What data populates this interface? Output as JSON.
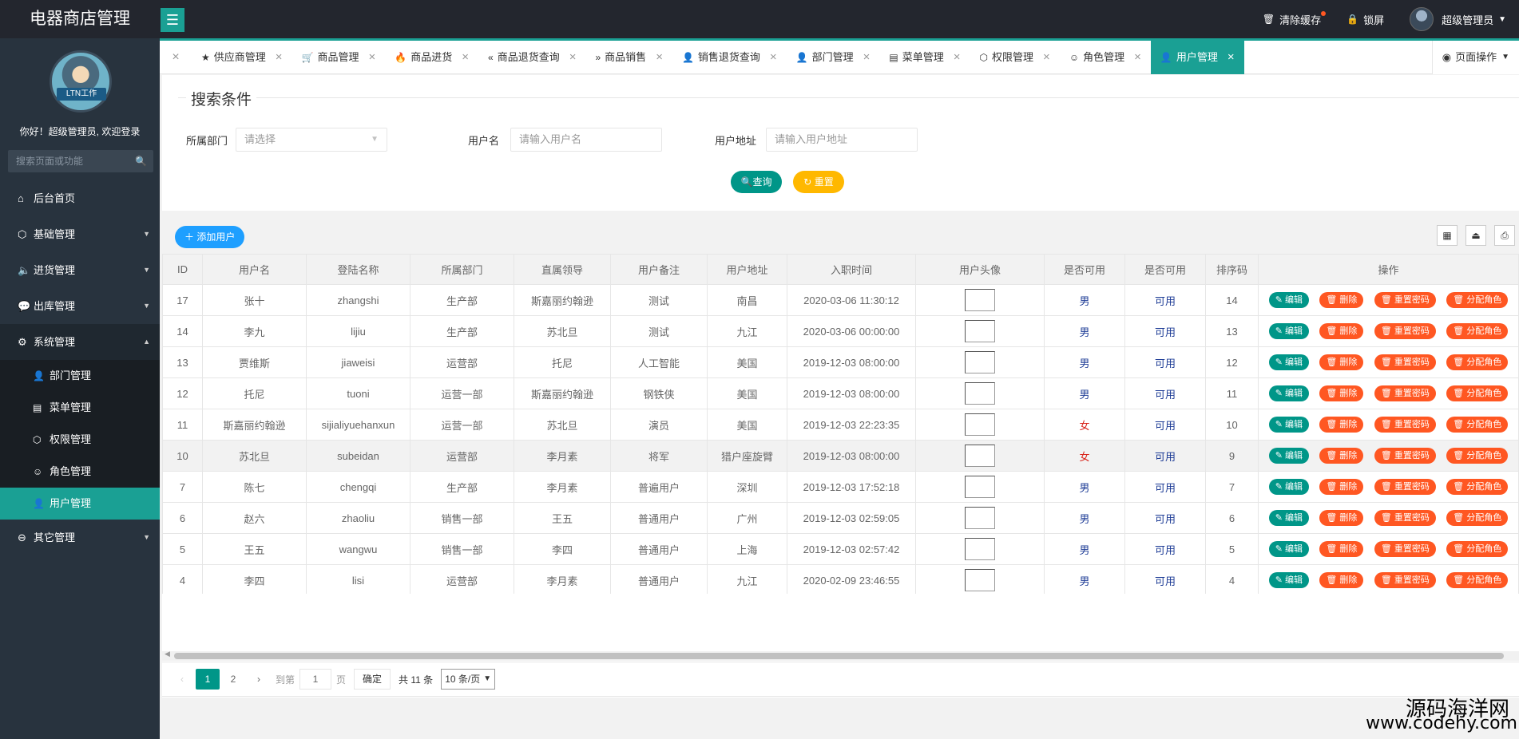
{
  "header": {
    "app_title": "电器商店管理",
    "clear_cache": "清除缓存",
    "lock_screen": "锁屏",
    "user_name": "超级管理员"
  },
  "sidebar": {
    "avatar_caption": "LTN工作",
    "welcome": "你好！超级管理员, 欢迎登录",
    "search_placeholder": "搜索页面或功能",
    "nav": [
      {
        "label": "后台首页",
        "icon": "home-icon"
      },
      {
        "label": "基础管理",
        "icon": "cube-icon"
      },
      {
        "label": "进货管理",
        "icon": "volume-icon"
      },
      {
        "label": "出库管理",
        "icon": "chat-icon"
      },
      {
        "label": "系统管理",
        "icon": "gear-icon"
      },
      {
        "label": "其它管理",
        "icon": "circle-arrow-icon"
      }
    ],
    "sub": [
      {
        "label": "部门管理",
        "icon": "user-outline-icon"
      },
      {
        "label": "菜单管理",
        "icon": "menu-icon"
      },
      {
        "label": "权限管理",
        "icon": "cube-icon"
      },
      {
        "label": "角色管理",
        "icon": "smile-icon"
      },
      {
        "label": "用户管理",
        "icon": "user-icon"
      }
    ]
  },
  "tabs": [
    {
      "label": "供应商管理",
      "icon": "star-icon"
    },
    {
      "label": "商品管理",
      "icon": "cart-icon"
    },
    {
      "label": "商品进货",
      "icon": "fire-icon"
    },
    {
      "label": "商品退货查询",
      "icon": "double-left-icon"
    },
    {
      "label": "商品销售",
      "icon": "double-right-icon"
    },
    {
      "label": "销售退货查询",
      "icon": "user-outline-icon"
    },
    {
      "label": "部门管理",
      "icon": "user-outline-icon"
    },
    {
      "label": "菜单管理",
      "icon": "menu-icon"
    },
    {
      "label": "权限管理",
      "icon": "cube-icon"
    },
    {
      "label": "角色管理",
      "icon": "smile-icon"
    },
    {
      "label": "用户管理",
      "icon": "user-icon"
    }
  ],
  "tab_ops": "页面操作",
  "search": {
    "legend": "搜索条件",
    "dept_label": "所属部门",
    "dept_placeholder": "请选择",
    "username_label": "用户名",
    "username_placeholder": "请输入用户名",
    "address_label": "用户地址",
    "address_placeholder": "请输入用户地址",
    "query_btn": "查询",
    "reset_btn": "重置"
  },
  "toolbar": {
    "add_btn": "添加用户"
  },
  "table": {
    "headers": [
      "ID",
      "用户名",
      "登陆名称",
      "所属部门",
      "直属领导",
      "用户备注",
      "用户地址",
      "入职时间",
      "用户头像",
      "是否可用",
      "是否可用",
      "排序码",
      "操作"
    ],
    "ops": {
      "edit": "编辑",
      "delete": "删除",
      "reset_pwd": "重置密码",
      "assign_role": "分配角色"
    },
    "rows": [
      {
        "id": "17",
        "name": "张十",
        "login": "zhangshi",
        "dept": "生产部",
        "leader": "斯嘉丽约翰逊",
        "remark": "测试",
        "address": "南昌",
        "time": "2020-03-06 11:30:12",
        "sex": "男",
        "avail": "可用",
        "order": "14"
      },
      {
        "id": "14",
        "name": "李九",
        "login": "lijiu",
        "dept": "生产部",
        "leader": "苏北旦",
        "remark": "测试",
        "address": "九江",
        "time": "2020-03-06 00:00:00",
        "sex": "男",
        "avail": "可用",
        "order": "13"
      },
      {
        "id": "13",
        "name": "贾维斯",
        "login": "jiaweisi",
        "dept": "运营部",
        "leader": "托尼",
        "remark": "人工智能",
        "address": "美国",
        "time": "2019-12-03 08:00:00",
        "sex": "男",
        "avail": "可用",
        "order": "12"
      },
      {
        "id": "12",
        "name": "托尼",
        "login": "tuoni",
        "dept": "运营一部",
        "leader": "斯嘉丽约翰逊",
        "remark": "钢铁侠",
        "address": "美国",
        "time": "2019-12-03 08:00:00",
        "sex": "男",
        "avail": "可用",
        "order": "11"
      },
      {
        "id": "11",
        "name": "斯嘉丽约翰逊",
        "login": "sijialiyuehanxun",
        "dept": "运营一部",
        "leader": "苏北旦",
        "remark": "演员",
        "address": "美国",
        "time": "2019-12-03 22:23:35",
        "sex": "女",
        "avail": "可用",
        "order": "10"
      },
      {
        "id": "10",
        "name": "苏北旦",
        "login": "subeidan",
        "dept": "运营部",
        "leader": "李月素",
        "remark": "将军",
        "address": "猎户座旋臂",
        "time": "2019-12-03 08:00:00",
        "sex": "女",
        "avail": "可用",
        "order": "9"
      },
      {
        "id": "7",
        "name": "陈七",
        "login": "chengqi",
        "dept": "生产部",
        "leader": "李月素",
        "remark": "普遍用户",
        "address": "深圳",
        "time": "2019-12-03 17:52:18",
        "sex": "男",
        "avail": "可用",
        "order": "7"
      },
      {
        "id": "6",
        "name": "赵六",
        "login": "zhaoliu",
        "dept": "销售一部",
        "leader": "王五",
        "remark": "普通用户",
        "address": "广州",
        "time": "2019-12-03 02:59:05",
        "sex": "男",
        "avail": "可用",
        "order": "6"
      },
      {
        "id": "5",
        "name": "王五",
        "login": "wangwu",
        "dept": "销售一部",
        "leader": "李四",
        "remark": "普通用户",
        "address": "上海",
        "time": "2019-12-03 02:57:42",
        "sex": "男",
        "avail": "可用",
        "order": "5"
      },
      {
        "id": "4",
        "name": "李四",
        "login": "lisi",
        "dept": "运营部",
        "leader": "李月素",
        "remark": "普通用户",
        "address": "九江",
        "time": "2020-02-09 23:46:55",
        "sex": "男",
        "avail": "可用",
        "order": "4"
      }
    ]
  },
  "pager": {
    "page1": "1",
    "page2": "2",
    "goto": "到第",
    "page_value": "1",
    "page_unit": "页",
    "confirm": "确定",
    "total": "共 11 条",
    "page_size": "10 条/页"
  },
  "watermark": {
    "line1": "源码海洋网",
    "line2": "www.codehy.com"
  },
  "colors": {
    "accent": "#1aa094",
    "primary_btn": "#009688",
    "warn_btn": "#ffb800",
    "danger_btn": "#ff5722",
    "add_btn": "#1e9fff",
    "header_bg": "#23262e",
    "sidebar_bg": "#28333e"
  }
}
